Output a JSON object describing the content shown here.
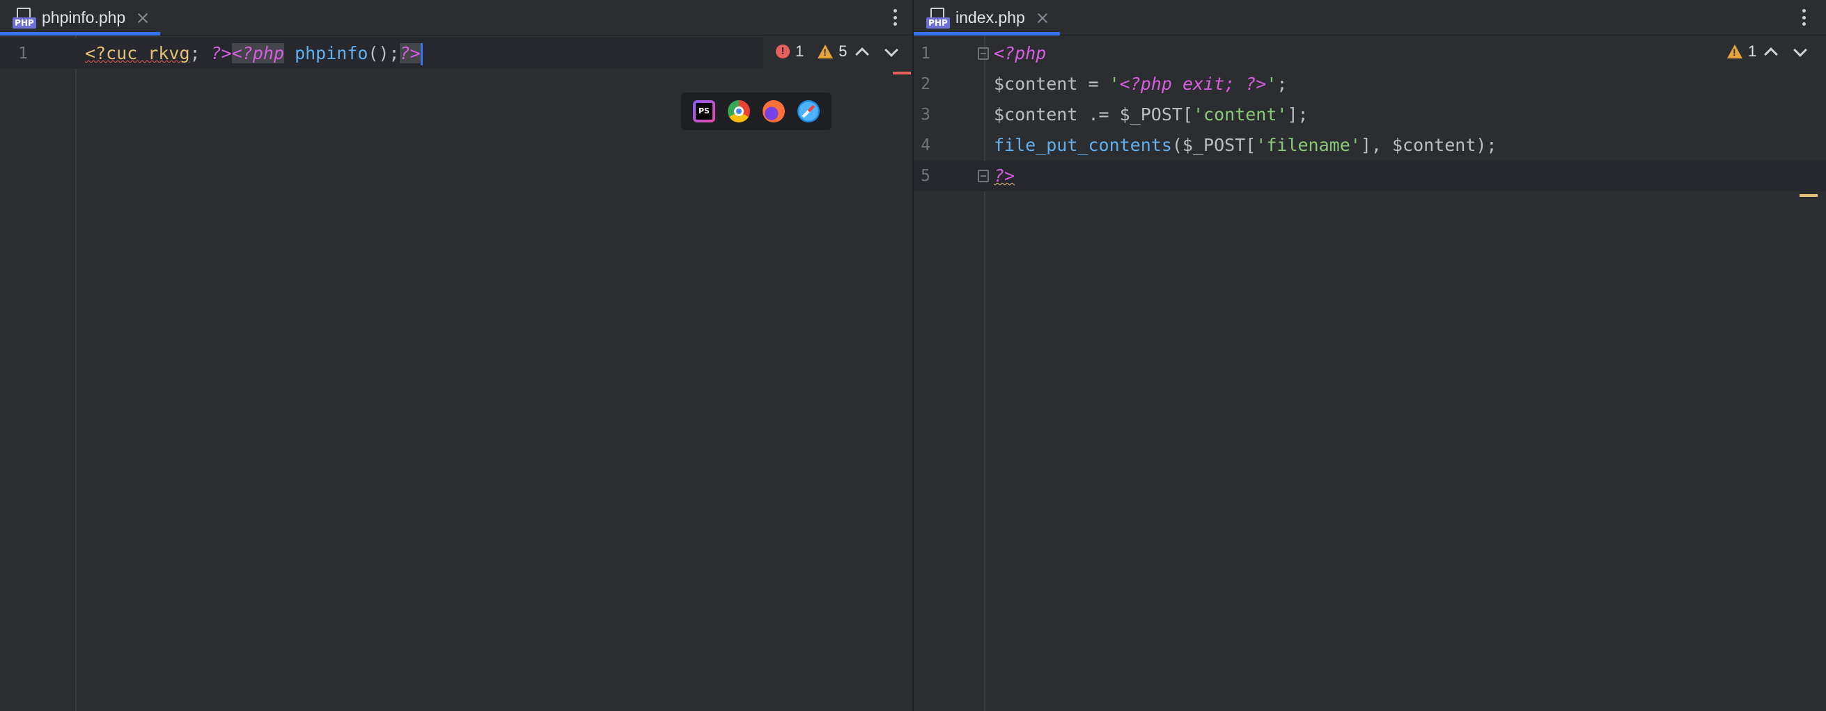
{
  "left": {
    "tab": {
      "label": "phpinfo.php",
      "icon": "php-file-icon",
      "icon_text": "PHP"
    },
    "inspection": {
      "errors": "1",
      "warnings": "5"
    },
    "lines": [
      {
        "number": "1",
        "code": "<?cuc rkvg; ?><?php phpinfo();?>"
      }
    ],
    "code_parts": {
      "a": "<?cuc rkvg",
      "b": "; ",
      "c": "?>",
      "d": "<?php",
      "e": " ",
      "f": "phpinfo",
      "g": "();",
      "h": "?>"
    },
    "browsers": [
      "phpstorm-icon",
      "chrome-icon",
      "firefox-icon",
      "safari-icon"
    ]
  },
  "right": {
    "tab": {
      "label": "index.php",
      "icon": "php-file-icon",
      "icon_text": "PHP"
    },
    "inspection": {
      "warnings": "1"
    },
    "line_numbers": [
      "1",
      "2",
      "3",
      "4",
      "5"
    ],
    "l1": {
      "kw": "<?php"
    },
    "l2": {
      "a": "$content = ",
      "b": "'",
      "c": "<?php exit; ?>",
      "d": "'",
      "e": ";"
    },
    "l3": {
      "a": "$content .= $_POST[",
      "b": "'content'",
      "c": "];"
    },
    "l4": {
      "fn": "file_put_contents",
      "a": "($_POST[",
      "b": "'filename'",
      "c": "], $content);"
    },
    "l5": {
      "kw": "?>"
    }
  },
  "colors": {
    "accent": "#3574f0",
    "keyword": "#d55fde",
    "string": "#89ca78",
    "function": "#61afef",
    "error": "#e55f5f",
    "warning": "#e5a33b"
  }
}
